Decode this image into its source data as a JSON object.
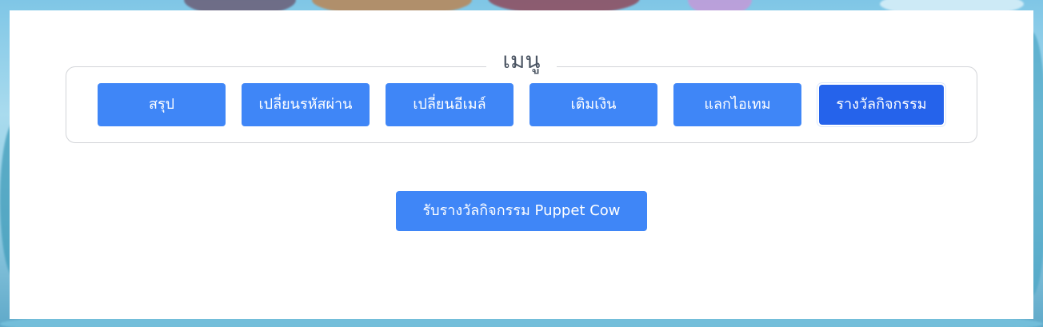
{
  "menu": {
    "title": "เมนู",
    "items": [
      {
        "label": "สรุป",
        "active": false
      },
      {
        "label": "เปลี่ยนรหัสผ่าน",
        "active": false
      },
      {
        "label": "เปลี่ยนอีเมล์",
        "active": false
      },
      {
        "label": "เติมเงิน",
        "active": false
      },
      {
        "label": "แลกไอเทม",
        "active": false
      },
      {
        "label": "รางวัลกิจกรรม",
        "active": true
      }
    ]
  },
  "main": {
    "claim_button_label": "รับรางวัลกิจกรรม Puppet Cow"
  },
  "colors": {
    "button": "#3f86f7",
    "button_active": "#2563eb",
    "panel": "#ffffff"
  }
}
